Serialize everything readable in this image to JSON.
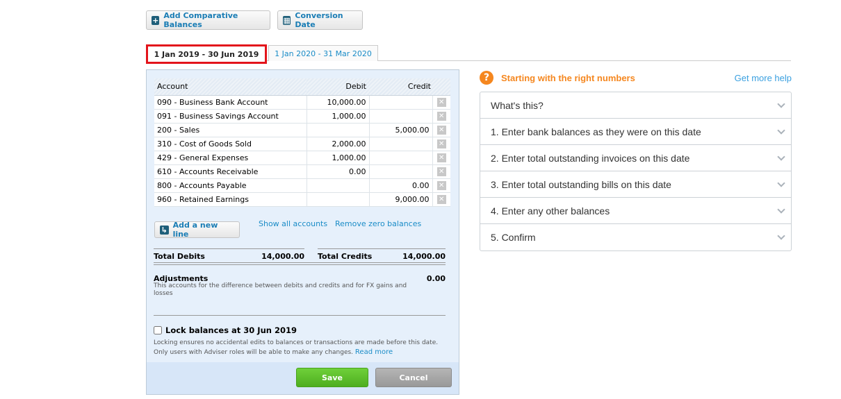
{
  "toolbar": {
    "add_comparative": "Add Comparative Balances",
    "conversion_date": "Conversion Date"
  },
  "tabs": [
    {
      "label": "1 Jan 2019 - 30 Jun 2019",
      "active": true
    },
    {
      "label": "1 Jan 2020 - 31 Mar 2020",
      "active": false
    }
  ],
  "table": {
    "headers": [
      "Account",
      "Debit",
      "Credit"
    ],
    "rows": [
      {
        "account": "090 - Business Bank Account",
        "debit": "10,000.00",
        "credit": ""
      },
      {
        "account": "091 - Business Savings Account",
        "debit": "1,000.00",
        "credit": ""
      },
      {
        "account": "200 - Sales",
        "debit": "",
        "credit": "5,000.00"
      },
      {
        "account": "310 - Cost of Goods Sold",
        "debit": "2,000.00",
        "credit": ""
      },
      {
        "account": "429 - General Expenses",
        "debit": "1,000.00",
        "credit": ""
      },
      {
        "account": "610 - Accounts Receivable",
        "debit": "0.00",
        "credit": ""
      },
      {
        "account": "800 - Accounts Payable",
        "debit": "",
        "credit": "0.00"
      },
      {
        "account": "960 - Retained Earnings",
        "debit": "",
        "credit": "9,000.00"
      }
    ]
  },
  "actions": {
    "add_line": "Add a new line",
    "show_all": "Show all accounts",
    "remove_zero": "Remove zero balances"
  },
  "totals": {
    "debits_label": "Total Debits",
    "debits": "14,000.00",
    "credits_label": "Total Credits",
    "credits": "14,000.00"
  },
  "adjustments": {
    "label": "Adjustments",
    "value": "0.00",
    "desc": "This accounts for the difference between debits and credits and for FX gains and losses"
  },
  "lock": {
    "label": "Lock balances at 30 Jun 2019",
    "checked": false,
    "desc": "Locking ensures no accidental edits to balances or transactions are made before this date. Only users with Adviser roles will be able to make any changes.",
    "read_more": "Read more"
  },
  "buttons": {
    "save": "Save",
    "cancel": "Cancel"
  },
  "help": {
    "title": "Starting with the right numbers",
    "more": "Get more help",
    "items": [
      "What's this?",
      "1. Enter bank balances as they were on this date",
      "2. Enter total outstanding invoices on this date",
      "3. Enter total outstanding bills on this date",
      "4. Enter any other balances",
      "5. Confirm"
    ]
  },
  "colors": {
    "accent": "#1a8cc7",
    "highlight": "#e3141b",
    "save": "#5bbf2a",
    "help_orange": "#f5871f"
  }
}
